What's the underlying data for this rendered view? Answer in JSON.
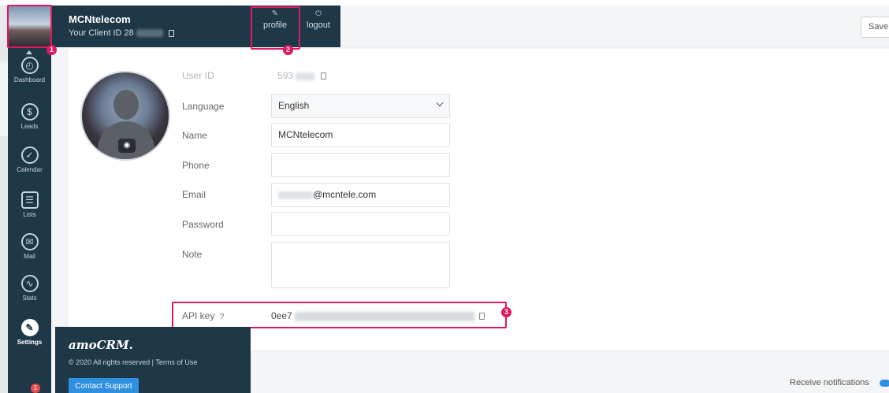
{
  "header": {
    "company_name": "MCNtelecom",
    "client_id_label": "Your Client ID 28",
    "profile_label": "profile",
    "logout_label": "logout",
    "save_label": "Save"
  },
  "sidebar": {
    "items": [
      {
        "label": "Dashboard",
        "icon": "dashboard-icon",
        "glyph": "◴"
      },
      {
        "label": "Leads",
        "icon": "leads-icon",
        "glyph": "$"
      },
      {
        "label": "Calendar",
        "icon": "calendar-icon",
        "glyph": "✓"
      },
      {
        "label": "Lists",
        "icon": "lists-icon",
        "glyph": "☰"
      },
      {
        "label": "Mail",
        "icon": "mail-icon",
        "glyph": "✉"
      },
      {
        "label": "Stats",
        "icon": "stats-icon",
        "glyph": "∿"
      },
      {
        "label": "Settings",
        "icon": "settings-icon",
        "glyph": "✎"
      }
    ],
    "notification_count": "1"
  },
  "annotations": {
    "marker_1": "1",
    "marker_2": "2",
    "marker_3": "3"
  },
  "form": {
    "user_id_label": "User ID",
    "user_id_value": "593",
    "language_label": "Language",
    "language_value": "English",
    "name_label": "Name",
    "name_value": "MCNtelecom",
    "phone_label": "Phone",
    "phone_value": "",
    "email_label": "Email",
    "email_value": "@mcntele.com",
    "password_label": "Password",
    "password_value": "",
    "note_label": "Note",
    "note_value": "",
    "api_key_label": "API key",
    "api_key_value": "0ee7"
  },
  "footer": {
    "logo": "amoCRM.",
    "copyright": "© 2020 All rights reserved | Terms of Use",
    "contact_label": "Contact Support"
  },
  "bottom_bar": {
    "receive_notifications_label": "Receive notifications"
  },
  "colors": {
    "sidebar_bg": "#1f3848",
    "highlight": "#e0195d",
    "accent_blue": "#2e90e0"
  }
}
